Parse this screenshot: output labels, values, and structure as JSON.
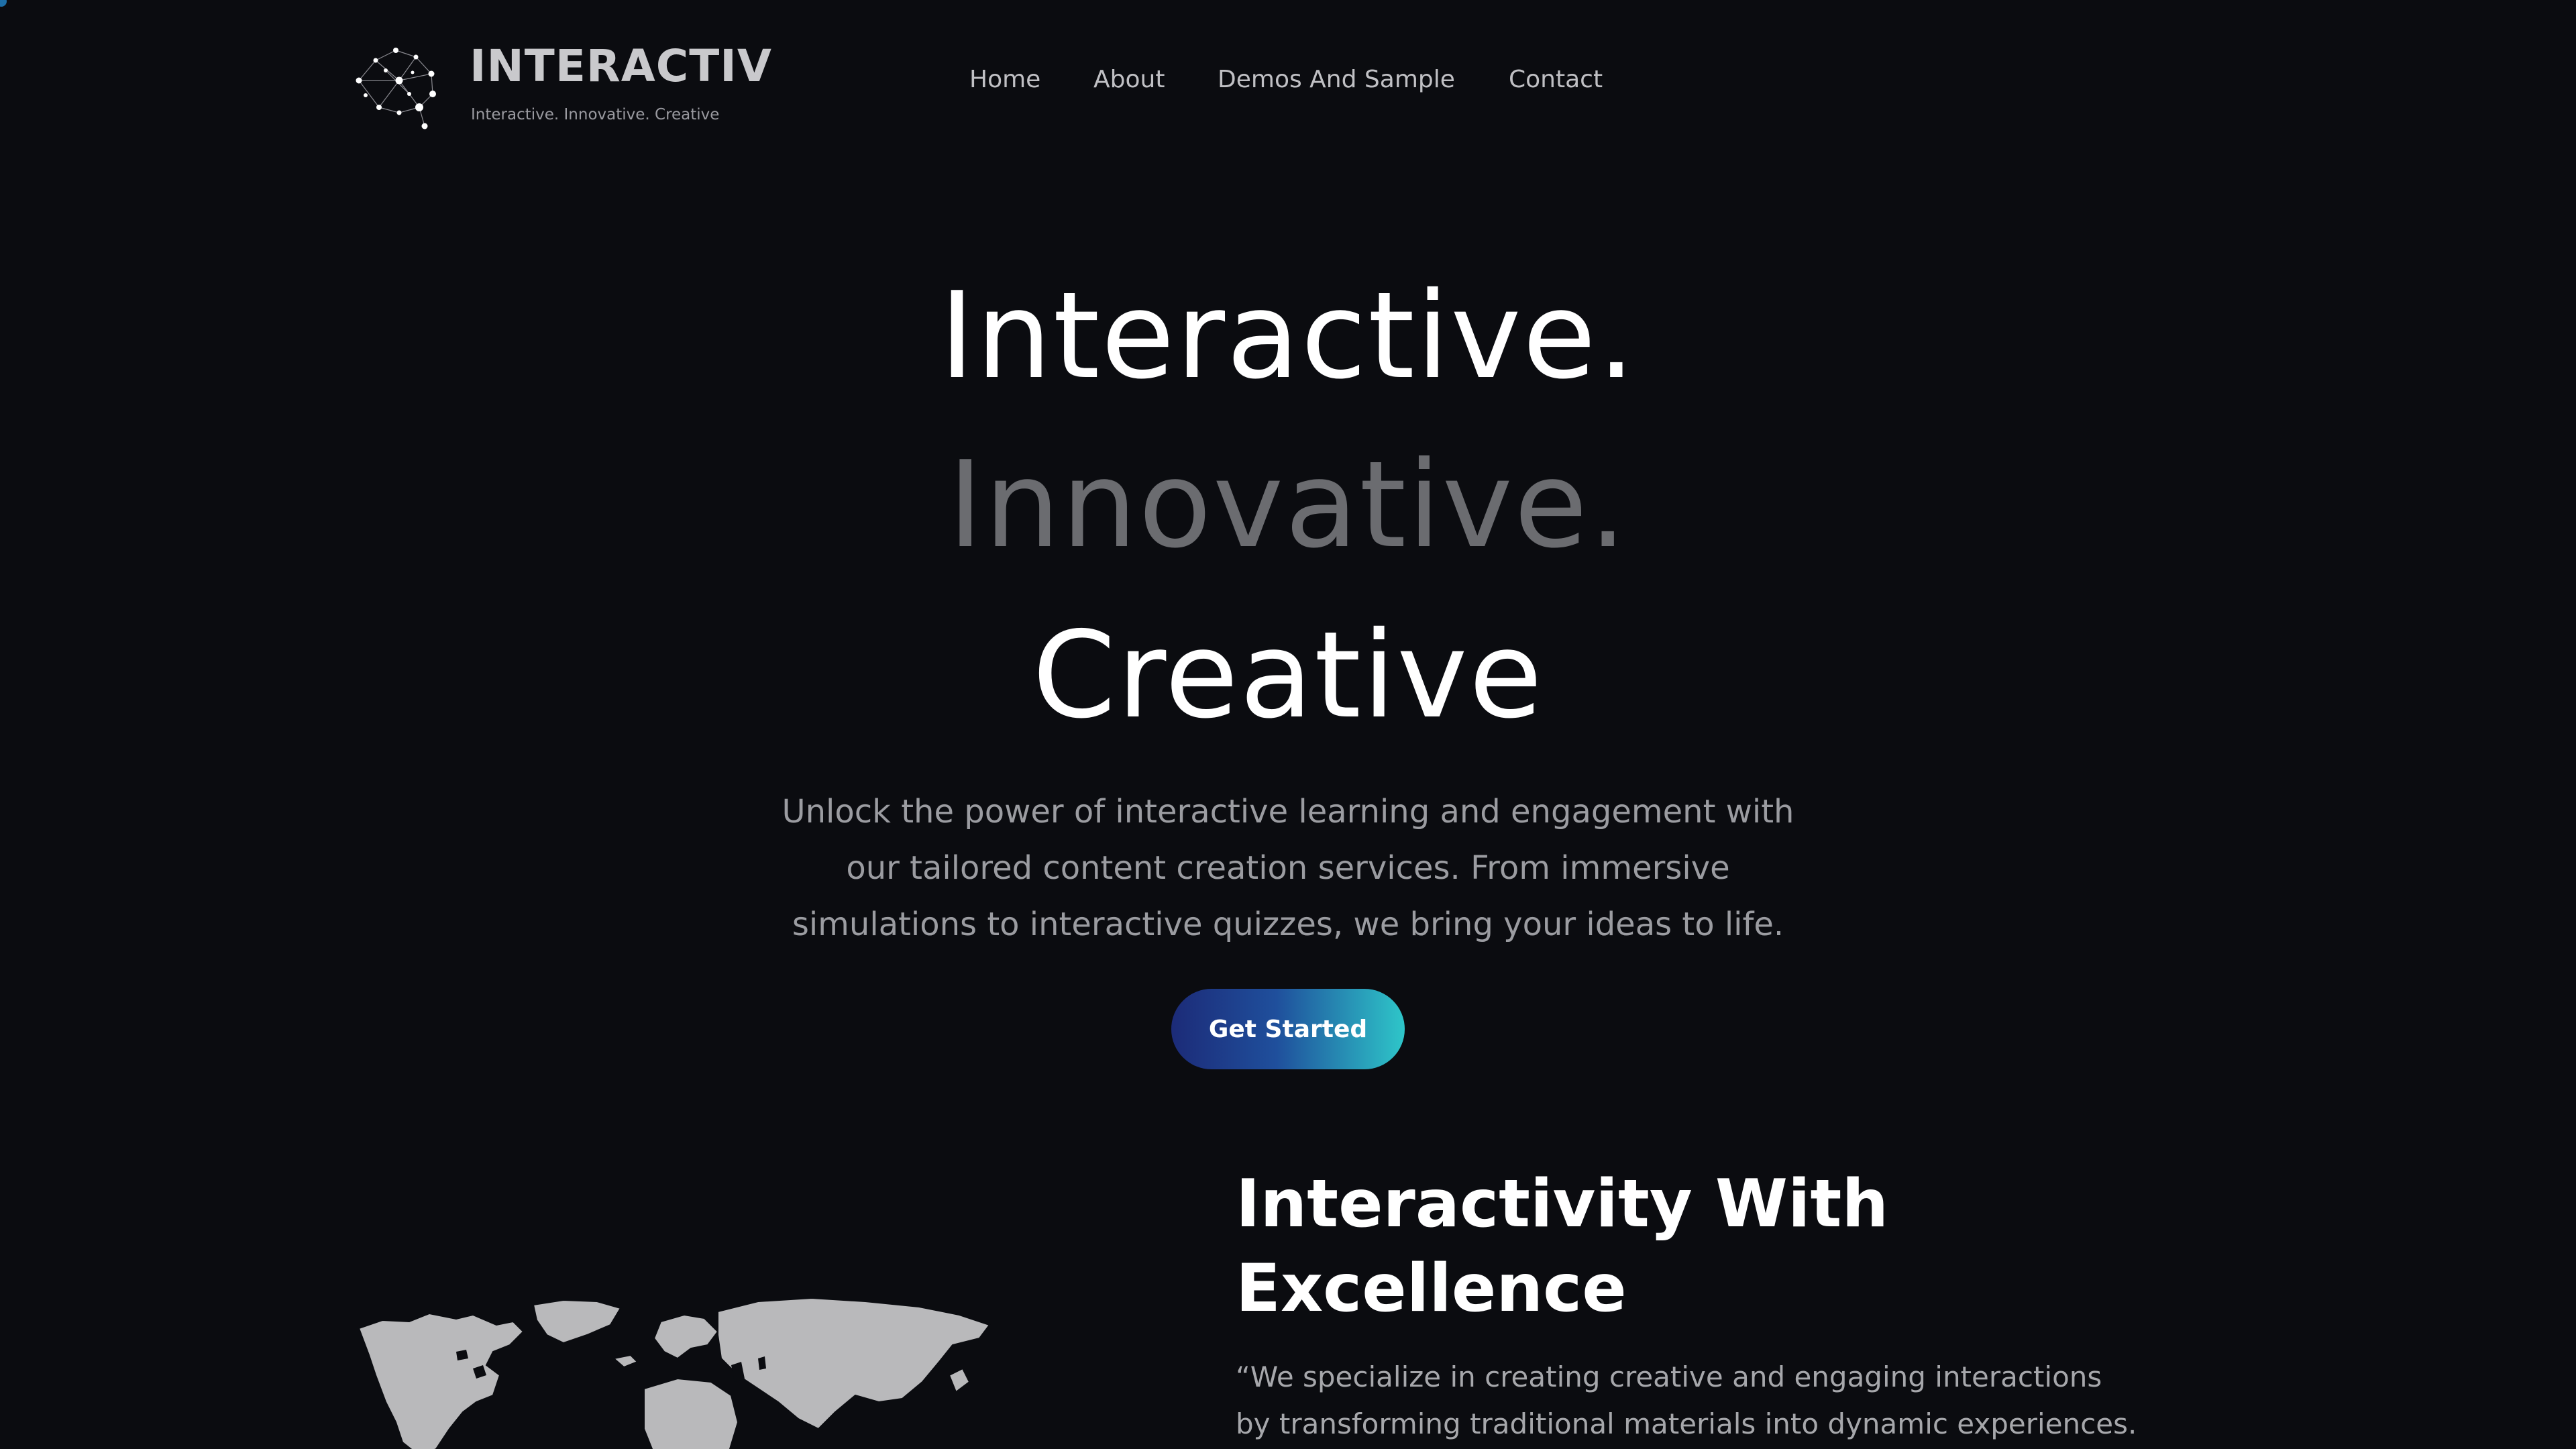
{
  "brand": {
    "name": "INTERACTIV",
    "tagline": "Interactive. Innovative. Creative",
    "logo_icon": "brain-network-icon"
  },
  "nav": {
    "items": [
      {
        "label": "Home"
      },
      {
        "label": "About"
      },
      {
        "label": "Demos And Sample"
      },
      {
        "label": "Contact"
      }
    ]
  },
  "hero": {
    "line1": "Interactive.",
    "line2": "Innovative.",
    "line3": "Creative",
    "description_lines": [
      "Unlock the power of interactive learning and engagement with",
      "our tailored content creation services. From immersive",
      "simulations to interactive quizzes, we bring your ideas to life."
    ],
    "cta_label": "Get Started"
  },
  "feature": {
    "title_lines": [
      "Interactivity With",
      "Excellence"
    ],
    "quote_lines": [
      "“We specialize in creating creative and engaging interactions",
      "by transforming traditional materials into dynamic experiences."
    ],
    "map_icon": "world-map-icon"
  },
  "colors": {
    "background": "#0b0c10",
    "cta_gradient_start": "#1c2b78",
    "cta_gradient_end": "#2ec6c9",
    "muted_text": "#9b9ca1",
    "hero_muted": "#6b6c70"
  }
}
